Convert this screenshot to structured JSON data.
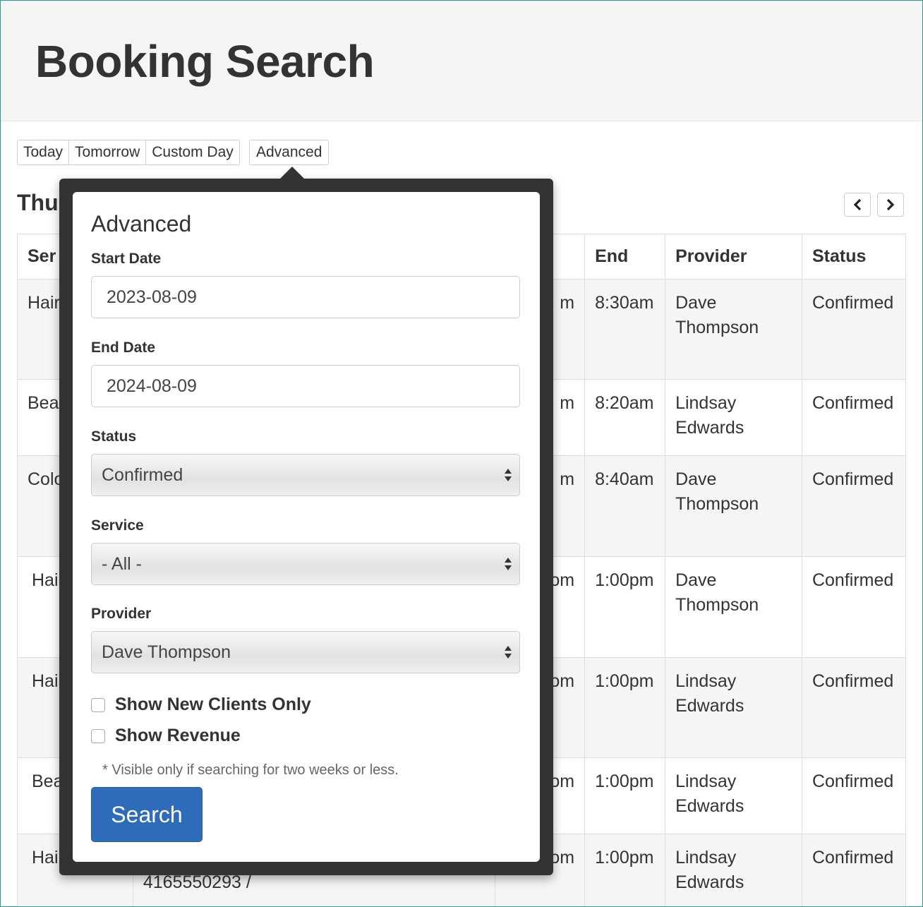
{
  "page": {
    "title": "Booking Search"
  },
  "quick_filters": [
    "Today",
    "Tomorrow",
    "Custom Day"
  ],
  "advanced_button": "Advanced",
  "day_title": "Thu",
  "table": {
    "headers": [
      "Ser",
      "End",
      "Provider",
      "Status"
    ],
    "rows": [
      {
        "service": "Hair",
        "start": "m",
        "end": "8:30am",
        "provider": "Dave Thompson",
        "status": "Confirmed"
      },
      {
        "service": "Bea",
        "start": "m",
        "end": "8:20am",
        "provider": "Lindsay Edwards",
        "status": "Confirmed"
      },
      {
        "service": "Colo",
        "start": "m",
        "end": "8:40am",
        "provider": "Dave Thompson",
        "status": "Confirmed"
      },
      {
        "service": "Hai",
        "start": "om",
        "end": "1:00pm",
        "provider": "Dave Thompson",
        "status": "Confirmed"
      },
      {
        "service": "Hai",
        "start": "om",
        "end": "1:00pm",
        "provider": "Lindsay Edwards",
        "status": "Confirmed"
      },
      {
        "service": "Bea",
        "start": "om",
        "end": "1:00pm",
        "provider": "Lindsay Edwards",
        "status": "Confirmed"
      },
      {
        "service": "Hai",
        "start": "om",
        "end": "1:00pm",
        "provider": "Lindsay Edwards",
        "status": "Confirmed",
        "client": "4165550293 /"
      }
    ]
  },
  "advanced": {
    "title": "Advanced",
    "start_date_label": "Start Date",
    "start_date_value": "2023-08-09",
    "end_date_label": "End Date",
    "end_date_value": "2024-08-09",
    "status_label": "Status",
    "status_value": "Confirmed",
    "service_label": "Service",
    "service_value": "- All -",
    "provider_label": "Provider",
    "provider_value": "Dave Thompson",
    "new_clients_label": "Show New Clients Only",
    "new_clients_checked": false,
    "revenue_label": "Show Revenue",
    "revenue_checked": false,
    "revenue_help": "* Visible only if searching for two weeks or less.",
    "search_label": "Search"
  },
  "colors": {
    "primary": "#2e6bb8",
    "popover_bg": "#333333",
    "hero_bg": "#f5f5f5",
    "frame_border": "#2a9a8e"
  }
}
